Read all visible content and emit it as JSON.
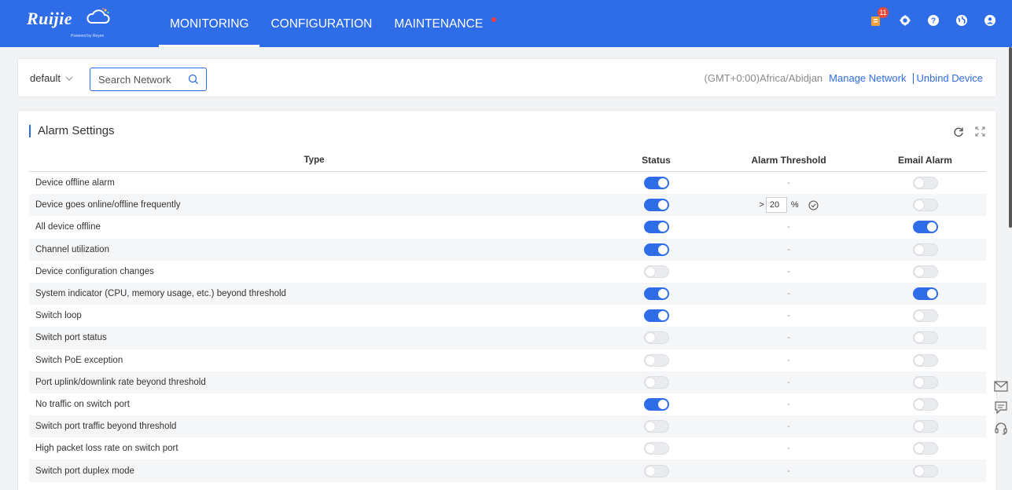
{
  "brand": {
    "logo_text": "Ruijie",
    "logo_sub": "Powered by Reyee"
  },
  "colors": {
    "primary": "#2e6ce8",
    "toggle_on": "#2e6ce8",
    "toggle_off": "#e9ebef"
  },
  "nav": {
    "monitoring": "MONITORING",
    "configuration": "CONFIGURATION",
    "maintenance": "MAINTENANCE",
    "active": "MONITORING"
  },
  "top_icons": {
    "notification_count": "11",
    "icons": [
      "notification-icon",
      "settings-icon",
      "help-icon",
      "language-icon",
      "user-icon"
    ]
  },
  "network_bar": {
    "network_select": "default",
    "search_placeholder": "Search Network",
    "timezone": "(GMT+0:00)Africa/Abidjan",
    "manage_network": "Manage Network",
    "unbind_device": "Unbind Device"
  },
  "alarm_settings": {
    "title": "Alarm Settings",
    "columns": {
      "type": "Type",
      "status": "Status",
      "threshold": "Alarm Threshold",
      "email": "Email Alarm"
    },
    "threshold_input": {
      "prefix": ">",
      "value": "20",
      "unit": "%"
    },
    "rows": [
      {
        "type": "Device offline alarm",
        "status": true,
        "threshold": "-",
        "email": false
      },
      {
        "type": "Device goes online/offline frequently",
        "status": true,
        "threshold": "input",
        "email": false
      },
      {
        "type": "All device offline",
        "status": true,
        "threshold": "-",
        "email": true
      },
      {
        "type": "Channel utilization",
        "status": true,
        "threshold": "-",
        "email": false
      },
      {
        "type": "Device configuration changes",
        "status": false,
        "threshold": "-",
        "email": false
      },
      {
        "type": "System indicator (CPU, memory usage, etc.) beyond threshold",
        "status": true,
        "threshold": "-",
        "email": true
      },
      {
        "type": "Switch loop",
        "status": true,
        "threshold": "-",
        "email": false
      },
      {
        "type": "Switch port status",
        "status": false,
        "threshold": "-",
        "email": false
      },
      {
        "type": "Switch PoE exception",
        "status": false,
        "threshold": "-",
        "email": false
      },
      {
        "type": "Port uplink/downlink rate beyond threshold",
        "status": false,
        "threshold": "-",
        "email": false
      },
      {
        "type": "No traffic on switch port",
        "status": true,
        "threshold": "-",
        "email": false
      },
      {
        "type": "Switch port traffic beyond threshold",
        "status": false,
        "threshold": "-",
        "email": false
      },
      {
        "type": "High packet loss rate on switch port",
        "status": false,
        "threshold": "-",
        "email": false
      },
      {
        "type": "Switch port duplex mode",
        "status": false,
        "threshold": "-",
        "email": false
      }
    ]
  },
  "side_float": [
    "mail-icon",
    "feedback-icon",
    "support-headset-icon"
  ]
}
